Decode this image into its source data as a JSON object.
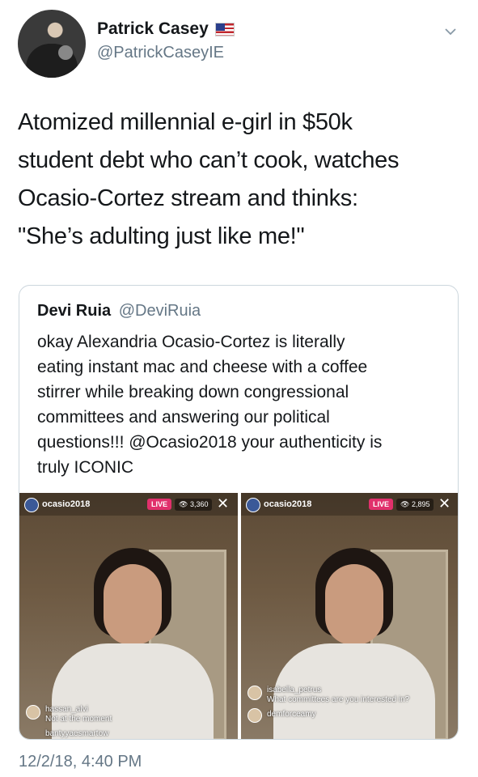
{
  "author": {
    "name": "Patrick Casey",
    "handle": "@PatrickCaseyIE",
    "flag_icon": "us-flag-icon"
  },
  "tweet": {
    "lines": [
      "Atomized millennial e-girl in $50k",
      "student debt who can’t cook, watches",
      "Ocasio-Cortez stream and thinks:",
      "\"She’s adulting just like me!\""
    ],
    "timestamp": "12/2/18, 4:40 PM"
  },
  "quoted": {
    "name": "Devi Ruia",
    "handle": "@DeviRuia",
    "lines": [
      "okay Alexandria Ocasio-Cortez is literally",
      "eating instant mac and cheese with a coffee",
      "stirrer while breaking down congressional",
      "committees and answering our political",
      "questions!!! @Ocasio2018 your authenticity is",
      "truly ICONIC"
    ]
  },
  "media": [
    {
      "user": "ocasio2018",
      "live": "LIVE",
      "viewers": "3,360",
      "close": "✕",
      "comments": [
        {
          "user": "hassan_alvi",
          "text": "Not at the moment"
        },
        {
          "user": "bantyyaesmartow",
          "text": ""
        }
      ]
    },
    {
      "user": "ocasio2018",
      "live": "LIVE",
      "viewers": "2,895",
      "close": "✕",
      "comments": [
        {
          "user": "isabella_petrus",
          "text": "What committees are you interested in?"
        },
        {
          "user": "demforceamy",
          "text": ""
        }
      ]
    }
  ],
  "colors": {
    "text": "#14171a",
    "secondary": "#657786",
    "border": "#ccd6dd",
    "live": "#e1306c"
  }
}
